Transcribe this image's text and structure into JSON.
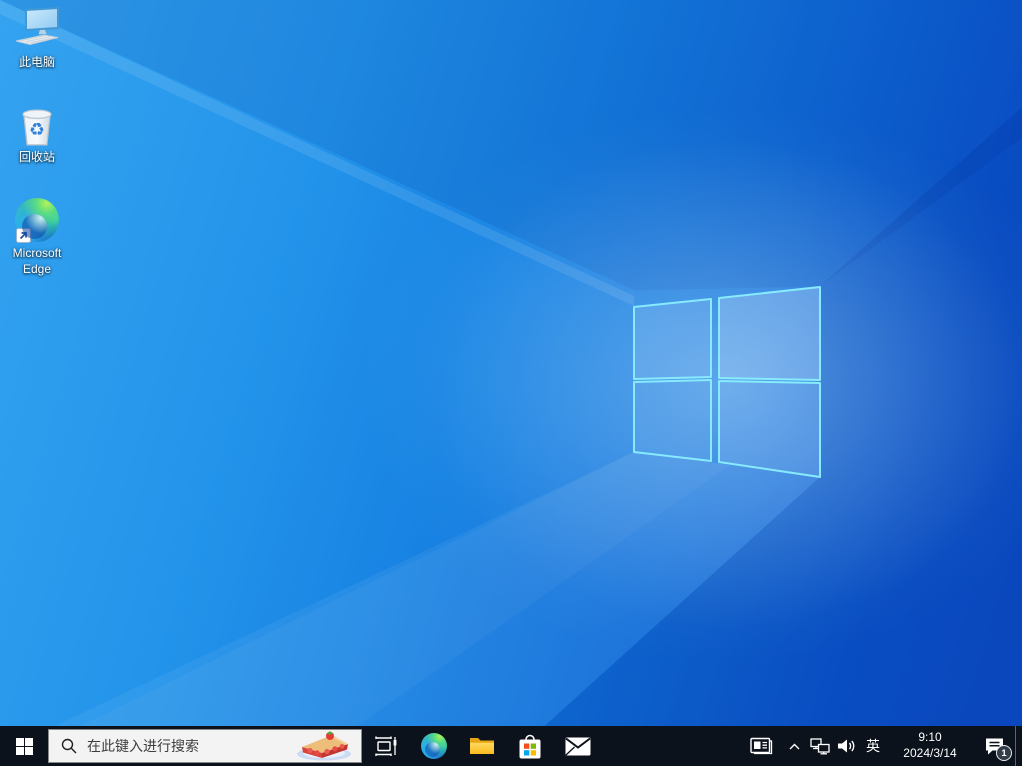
{
  "wallpaper": {
    "base_light": "#34a3f0",
    "base_dark": "#0c4cc6",
    "logo_stroke": "#87eafd"
  },
  "desktop_icons": [
    {
      "id": "this-pc",
      "label": "此电脑"
    },
    {
      "id": "recycle-bin",
      "label": "回收站"
    },
    {
      "id": "microsoft-edge",
      "label": "Microsoft Edge"
    }
  ],
  "taskbar": {
    "background": "#0c121c",
    "search": {
      "placeholder": "在此键入进行搜索",
      "highlight_icon": "strawberry-pie"
    },
    "pinned_icons": [
      "start",
      "task-view",
      "microsoft-edge",
      "file-explorer",
      "microsoft-store",
      "mail"
    ],
    "tray": {
      "icons": [
        "news-and-interests",
        "hidden-icons-chevron",
        "network",
        "volume",
        "ime",
        "clock",
        "action-center",
        "show-desktop"
      ],
      "ime_indicator": "英",
      "time": "9:10",
      "date": "2024/3/14",
      "notification_badge": "1"
    }
  }
}
